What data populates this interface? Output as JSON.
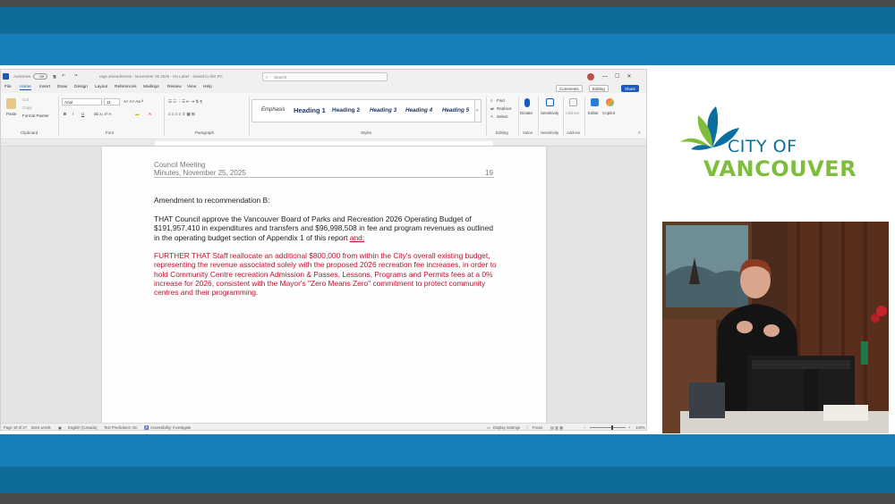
{
  "broadcast": {
    "accent_dark": "#0f6b98",
    "accent": "#1480b7"
  },
  "word": {
    "titlebar": {
      "autosave_label": "AutoSave",
      "autosave_state": "Off",
      "doc_name": "regs amendments - November 25 2025 · No Label · Saved to this PC",
      "search_placeholder": "Search"
    },
    "tabs": [
      "File",
      "Home",
      "Insert",
      "Draw",
      "Design",
      "Layout",
      "References",
      "Mailings",
      "Review",
      "View",
      "Help"
    ],
    "active_tab": "Home",
    "buttons": {
      "comments": "Comments",
      "editing": "Editing",
      "share": "Share"
    },
    "ribbon": {
      "clipboard": {
        "paste": "Paste",
        "cut": "Cut",
        "copy": "Copy",
        "format_painter": "Format Painter",
        "label": "Clipboard"
      },
      "font": {
        "name": "Arial",
        "size": "11",
        "label": "Font"
      },
      "paragraph_label": "Paragraph",
      "styles": [
        "Emphasis",
        "Heading 1",
        "Heading 2",
        "Heading 3",
        "Heading 4",
        "Heading 5"
      ],
      "styles_label": "Styles",
      "editing": {
        "find": "Find",
        "replace": "Replace",
        "select": "Select",
        "label": "Editing"
      },
      "voice": {
        "dictate": "Dictate",
        "label": "Voice"
      },
      "sensitivity": {
        "button": "Sensitivity",
        "label": "Sensitivity"
      },
      "addins": {
        "button": "Add-ins",
        "label": "Add-ins"
      },
      "editor": "Editor",
      "copilot": "Copilot"
    },
    "document": {
      "header_line1": "Council Meeting",
      "header_line2": "Minutes, November 25, 2025",
      "page_number": "19",
      "heading": "Amendment to recommendation B:",
      "para1": "THAT Council approve the Vancouver Board of Parks and Recreation 2026 Operating Budget of $191,957,410 in expenditures and transfers and $96,998,508 in fee and program revenues as outlined in the operating budget section of Appendix 1 of this report",
      "para1_added": "and;",
      "para2": "FURTHER THAT Staff reallocate an additional $800,000 from within the City's overall existing budget, representing the revenue associated solely with the proposed 2026 recreation fee increases, in order to hold Community Centre recreation Admission & Passes, Lessons, Programs and Permits fees at a 0% increase for 2026, consistent with the Mayor's \"Zero Means Zero\" commitment to protect community centres and their programming."
    },
    "status": {
      "page": "Page 19 of 27",
      "words": "5844 words",
      "language": "English (Canada)",
      "predictions": "Text Predictions: On",
      "accessibility": "Accessibility: Investigate",
      "display": "Display Settings",
      "focus": "Focus",
      "zoom": "140%"
    }
  },
  "logo": {
    "line1": "CITY OF",
    "line2": "VANCOUVER"
  }
}
